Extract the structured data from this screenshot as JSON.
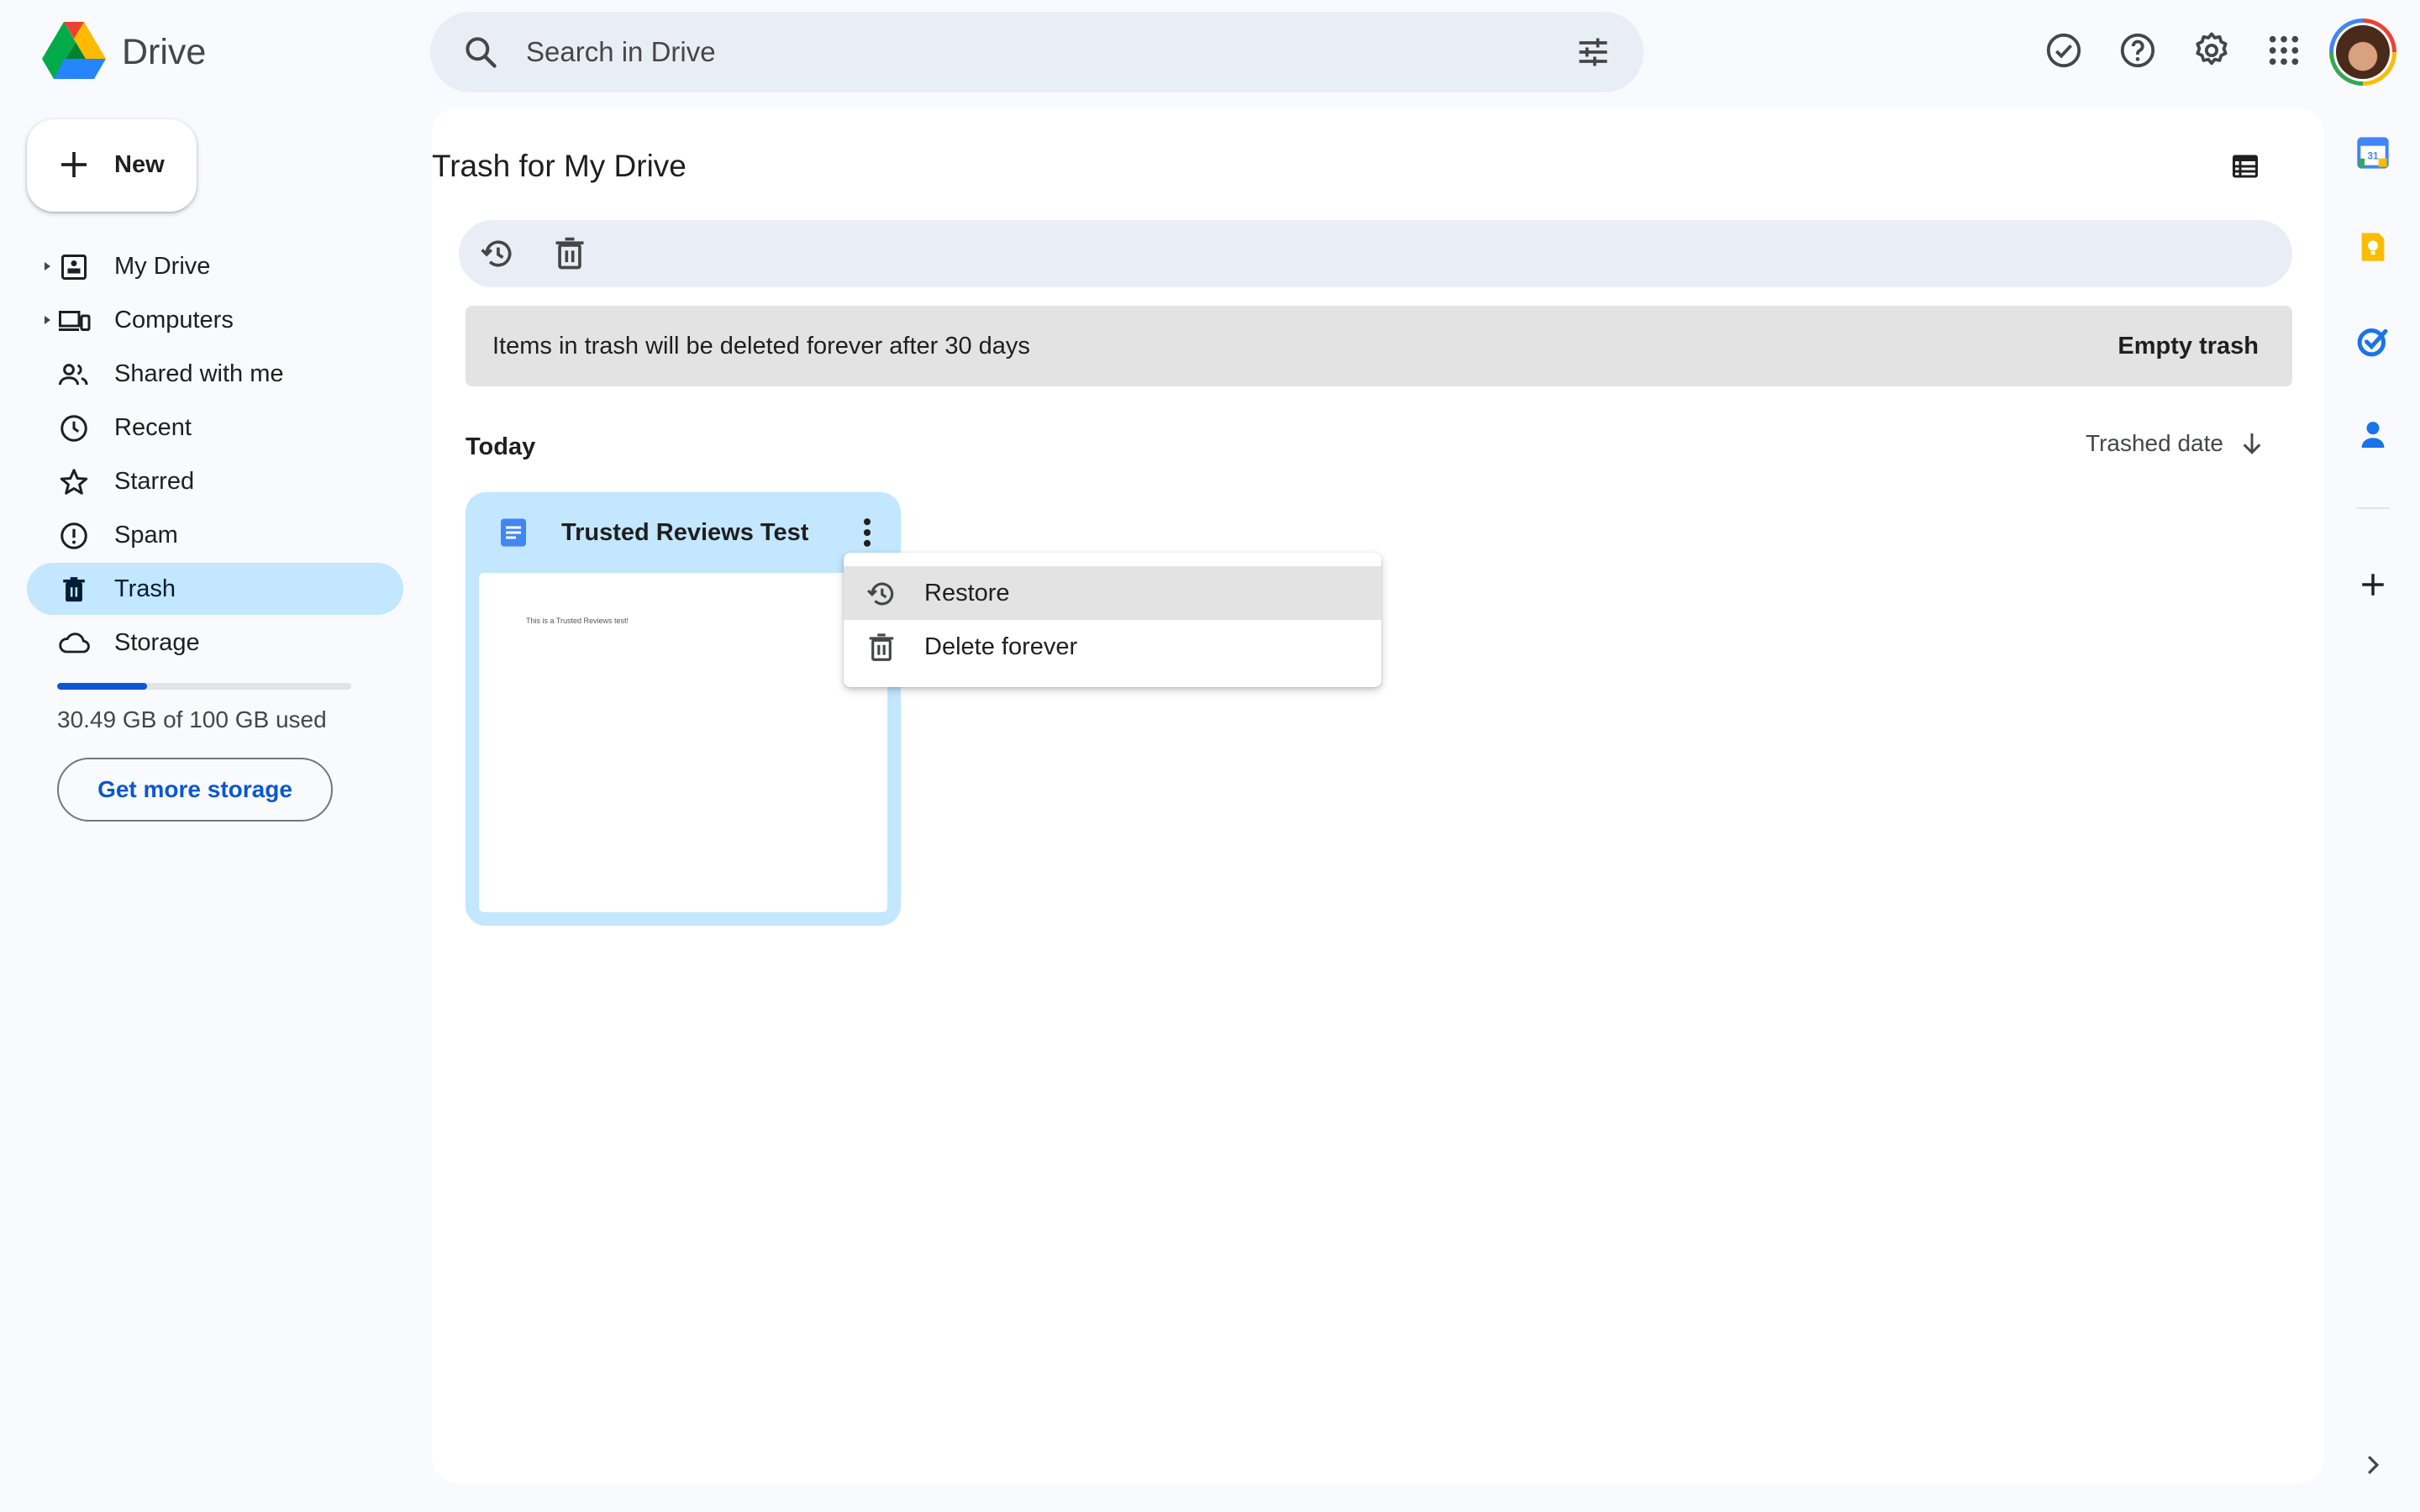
{
  "app": {
    "name": "Drive"
  },
  "search": {
    "placeholder": "Search in Drive"
  },
  "sidebar": {
    "new_label": "New",
    "items": [
      {
        "label": "My Drive",
        "icon": "my-drive-icon",
        "expandable": true
      },
      {
        "label": "Computers",
        "icon": "computers-icon",
        "expandable": true
      },
      {
        "label": "Shared with me",
        "icon": "shared-icon",
        "expandable": false
      },
      {
        "label": "Recent",
        "icon": "clock-icon",
        "expandable": false
      },
      {
        "label": "Starred",
        "icon": "star-icon",
        "expandable": false
      },
      {
        "label": "Spam",
        "icon": "spam-icon",
        "expandable": false
      },
      {
        "label": "Trash",
        "icon": "trash-icon",
        "expandable": false,
        "active": true
      },
      {
        "label": "Storage",
        "icon": "cloud-icon",
        "expandable": false
      }
    ],
    "storage": {
      "used_text": "30.49 GB of 100 GB used",
      "used_fraction": 0.3049,
      "button_label": "Get more storage"
    }
  },
  "main": {
    "title": "Trash for My Drive",
    "banner": {
      "text": "Items in trash will be deleted forever after 30 days",
      "action_label": "Empty trash"
    },
    "sections": [
      {
        "label": "Today"
      }
    ],
    "sort": {
      "label": "Trashed date",
      "direction": "descending"
    },
    "files": [
      {
        "name": "Trusted Reviews Test",
        "type": "google-doc",
        "preview_text": "This is a Trusted Reviews test!"
      }
    ]
  },
  "context_menu": {
    "items": [
      {
        "label": "Restore",
        "icon": "restore-icon",
        "highlighted": true
      },
      {
        "label": "Delete forever",
        "icon": "trash-icon",
        "highlighted": false
      }
    ]
  },
  "colors": {
    "page_bg": "#f8fafd",
    "accent": "#0b57d0",
    "selected_bg": "#c2e7ff",
    "toolbar_bg": "#e9eef6",
    "banner_bg": "#e3e3e3"
  }
}
